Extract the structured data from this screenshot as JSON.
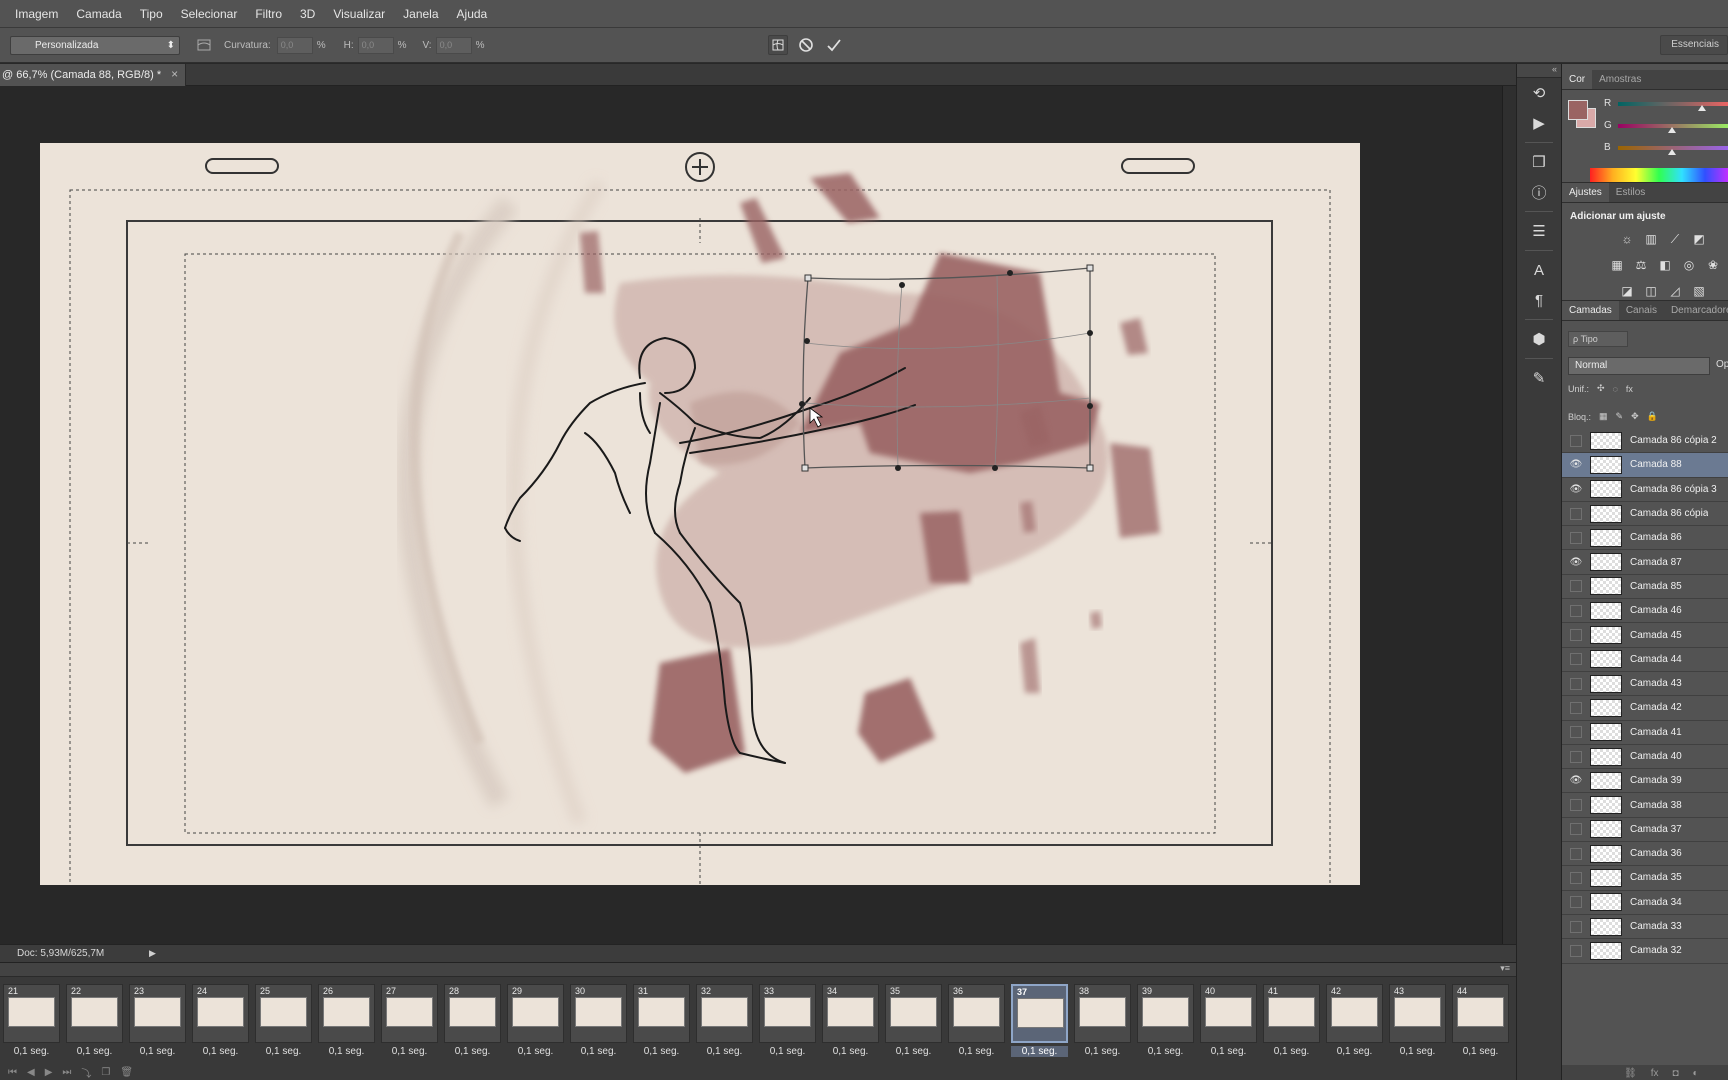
{
  "menu": [
    "Imagem",
    "Camada",
    "Tipo",
    "Selecionar",
    "Filtro",
    "3D",
    "Visualizar",
    "Janela",
    "Ajuda"
  ],
  "options": {
    "preset": "Personalizada",
    "curvature_label": "Curvatura:",
    "curvature_value": "0,0",
    "h_label": "H:",
    "h_value": "0,0",
    "v_label": "V:",
    "v_value": "0,0",
    "percent": "%",
    "workspace": "Essenciais"
  },
  "document": {
    "tab_title": "@ 66,7% (Camada 88, RGB/8) *",
    "close": "×",
    "paper_color": "#ece3d9",
    "ink_color": "#9a6463"
  },
  "status": {
    "doc_size": "Doc: 5,93M/625,7M"
  },
  "timeline": {
    "selected_frame": "37",
    "frames": [
      {
        "num": "21",
        "delay": "0,1 seg."
      },
      {
        "num": "22",
        "delay": "0,1 seg."
      },
      {
        "num": "23",
        "delay": "0,1 seg."
      },
      {
        "num": "24",
        "delay": "0,1 seg."
      },
      {
        "num": "25",
        "delay": "0,1 seg."
      },
      {
        "num": "26",
        "delay": "0,1 seg."
      },
      {
        "num": "27",
        "delay": "0,1 seg."
      },
      {
        "num": "28",
        "delay": "0,1 seg."
      },
      {
        "num": "29",
        "delay": "0,1 seg."
      },
      {
        "num": "30",
        "delay": "0,1 seg."
      },
      {
        "num": "31",
        "delay": "0,1 seg."
      },
      {
        "num": "32",
        "delay": "0,1 seg."
      },
      {
        "num": "33",
        "delay": "0,1 seg."
      },
      {
        "num": "34",
        "delay": "0,1 seg."
      },
      {
        "num": "35",
        "delay": "0,1 seg."
      },
      {
        "num": "36",
        "delay": "0,1 seg."
      },
      {
        "num": "37",
        "delay": "0,1 seg."
      },
      {
        "num": "38",
        "delay": "0,1 seg."
      },
      {
        "num": "39",
        "delay": "0,1 seg."
      },
      {
        "num": "40",
        "delay": "0,1 seg."
      },
      {
        "num": "41",
        "delay": "0,1 seg."
      },
      {
        "num": "42",
        "delay": "0,1 seg."
      },
      {
        "num": "43",
        "delay": "0,1 seg."
      },
      {
        "num": "44",
        "delay": "0,1 seg."
      }
    ]
  },
  "color_panel": {
    "tabs": [
      "Cor",
      "Amostras"
    ],
    "channels": [
      "R",
      "G",
      "B"
    ],
    "channel_levels": [
      0.7,
      0.45,
      0.45
    ],
    "fg_color": "#9a6463",
    "bg_color": "#d9a9a8"
  },
  "adjustments": {
    "tabs": [
      "Ajustes",
      "Estilos"
    ],
    "title": "Adicionar um ajuste"
  },
  "layers": {
    "tabs": [
      "Camadas",
      "Canais",
      "Demarcadores"
    ],
    "filter": "ρ Tipo",
    "blend_mode": "Normal",
    "opacity_label": "Op",
    "unify_label": "Unif.:",
    "lock_label": "Bloq.:",
    "items": [
      {
        "name": "Camada 86 cópia 2",
        "visible": false,
        "selected": false
      },
      {
        "name": "Camada 88",
        "visible": true,
        "selected": true
      },
      {
        "name": "Camada 86 cópia 3",
        "visible": true,
        "selected": false
      },
      {
        "name": "Camada 86 cópia",
        "visible": false,
        "selected": false
      },
      {
        "name": "Camada 86",
        "visible": false,
        "selected": false
      },
      {
        "name": "Camada 87",
        "visible": true,
        "selected": false
      },
      {
        "name": "Camada 85",
        "visible": false,
        "selected": false
      },
      {
        "name": "Camada 46",
        "visible": false,
        "selected": false
      },
      {
        "name": "Camada 45",
        "visible": false,
        "selected": false
      },
      {
        "name": "Camada 44",
        "visible": false,
        "selected": false
      },
      {
        "name": "Camada 43",
        "visible": false,
        "selected": false
      },
      {
        "name": "Camada 42",
        "visible": false,
        "selected": false
      },
      {
        "name": "Camada 41",
        "visible": false,
        "selected": false
      },
      {
        "name": "Camada 40",
        "visible": false,
        "selected": false
      },
      {
        "name": "Camada 39",
        "visible": true,
        "selected": false
      },
      {
        "name": "Camada 38",
        "visible": false,
        "selected": false
      },
      {
        "name": "Camada 37",
        "visible": false,
        "selected": false
      },
      {
        "name": "Camada 36",
        "visible": false,
        "selected": false
      },
      {
        "name": "Camada 35",
        "visible": false,
        "selected": false
      },
      {
        "name": "Camada 34",
        "visible": false,
        "selected": false
      },
      {
        "name": "Camada 33",
        "visible": false,
        "selected": false
      },
      {
        "name": "Camada 32",
        "visible": false,
        "selected": false
      }
    ]
  }
}
